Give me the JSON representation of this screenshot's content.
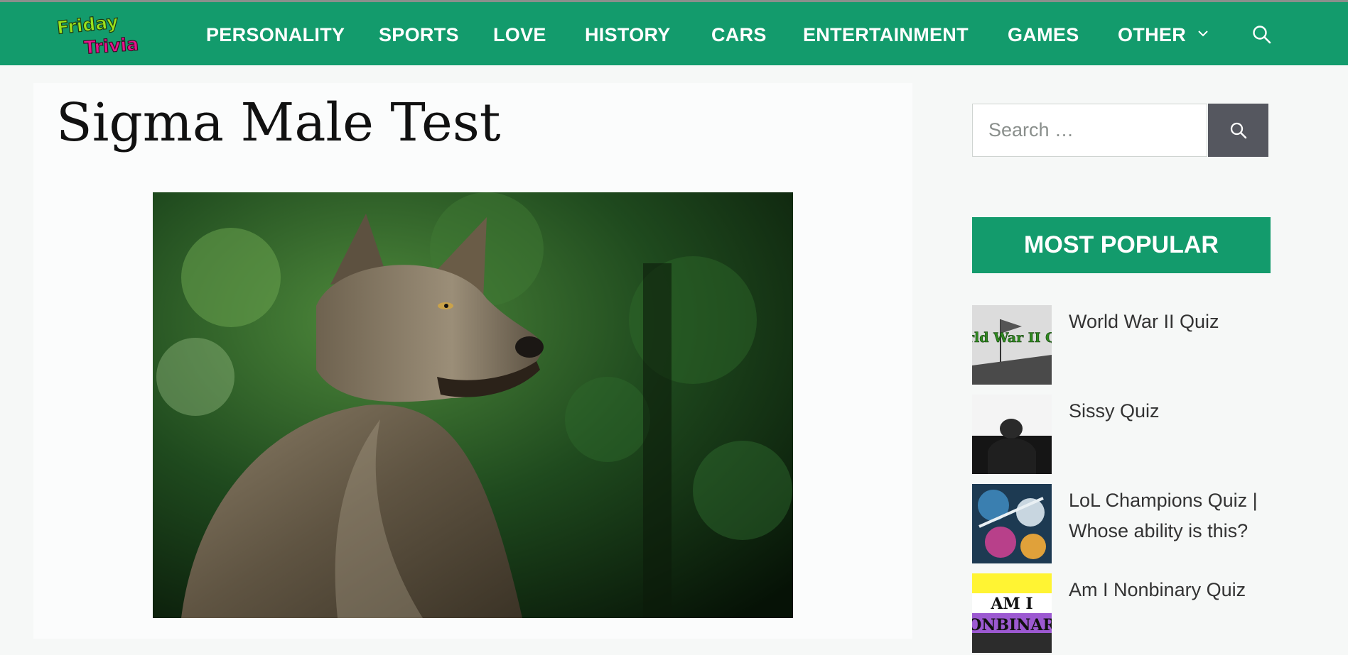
{
  "site": {
    "logo_text_line1": "Friday",
    "logo_text_line2": "Trivia"
  },
  "nav": {
    "items": [
      "PERSONALITY",
      "SPORTS",
      "LOVE",
      "HISTORY",
      "CARS",
      "ENTERTAINMENT",
      "GAMES",
      "OTHER"
    ],
    "other_icon": "chevron-down-icon",
    "search_icon": "search-icon"
  },
  "article": {
    "title": "Sigma Male Test",
    "hero_image": "wolf-photo"
  },
  "sidebar": {
    "search": {
      "placeholder": "Search …",
      "button_icon": "search-icon"
    },
    "popular": {
      "heading": "MOST POPULAR",
      "items": [
        {
          "title": "World War II Quiz",
          "thumb_text": "World War II Quiz"
        },
        {
          "title": "Sissy Quiz"
        },
        {
          "title": "LoL Champions Quiz | Whose ability is this?"
        },
        {
          "title": "Am I Nonbinary Quiz",
          "thumb_text_line1": "AM I",
          "thumb_text_line2": "ONBINAR"
        }
      ]
    }
  },
  "colors": {
    "brand_green": "#139b6c",
    "search_button": "#55575f",
    "page_bg": "#f6f8f7"
  }
}
